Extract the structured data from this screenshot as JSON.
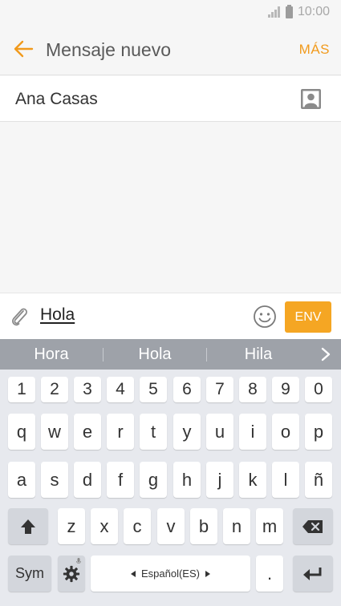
{
  "status_bar": {
    "time": "10:00"
  },
  "app_bar": {
    "title": "Mensaje nuevo",
    "more_label": "MÁS"
  },
  "recipient": {
    "name": "Ana Casas"
  },
  "compose": {
    "message": "Hola",
    "send_label": "ENV"
  },
  "suggestions": [
    "Hora",
    "Hola",
    "Hila"
  ],
  "keyboard": {
    "row1": [
      "1",
      "2",
      "3",
      "4",
      "5",
      "6",
      "7",
      "8",
      "9",
      "0"
    ],
    "row2": [
      "q",
      "w",
      "e",
      "r",
      "t",
      "y",
      "u",
      "i",
      "o",
      "p"
    ],
    "row3": [
      "a",
      "s",
      "d",
      "f",
      "g",
      "h",
      "j",
      "k",
      "l",
      "ñ"
    ],
    "row4": [
      "z",
      "x",
      "c",
      "v",
      "b",
      "n",
      "m"
    ],
    "sym_label": "Sym",
    "space_label": "Español(ES)",
    "period_label": "."
  },
  "colors": {
    "accent": "#f19a1c",
    "send_button": "#f5a623",
    "suggestion_bar": "#9ea2a9"
  }
}
